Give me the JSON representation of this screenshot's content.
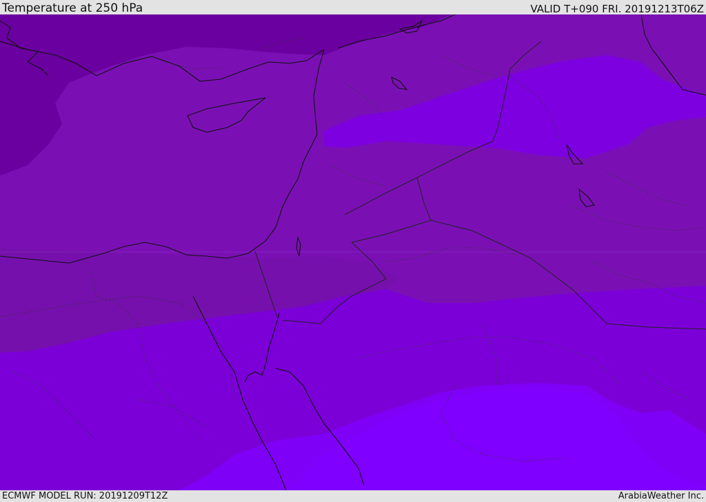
{
  "header": {
    "title": "Temperature at 250 hPa",
    "valid_time": "VALID T+090 FRI. 20191213T06Z"
  },
  "footer": {
    "model_run": "ECMWF MODEL RUN: 20191209T12Z",
    "credit": "ArabiaWeather Inc."
  },
  "map": {
    "colors": {
      "band_darkest": "#6a009f",
      "band_dark": "#7a10b4",
      "band_mid": "#7d00d8",
      "band_light": "#7a00f0",
      "band_lightest": "#8000ff",
      "coastline": "#111111",
      "border": "#222222"
    }
  }
}
